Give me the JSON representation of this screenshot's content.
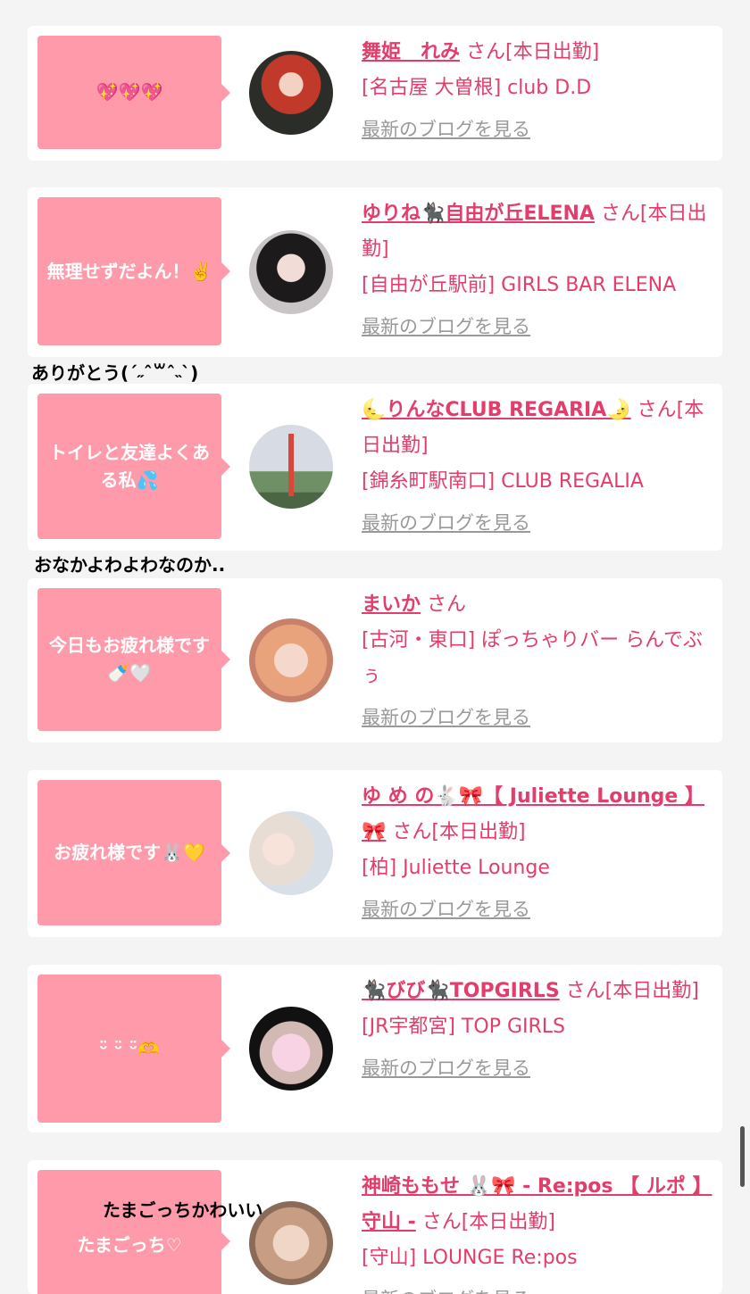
{
  "entries": [
    {
      "message": "💖💖💖",
      "name": "舞姫　れみ",
      "suffix": "さん[本日出勤]",
      "shop": "[名古屋 大曽根] club D.D",
      "blog_link": "最新のブログを見る"
    },
    {
      "message": "無理せずだよん！✌️",
      "name": "ゆりね🐈‍⬛自由が丘ELENA",
      "suffix": "さん[本日出勤]",
      "shop": "[自由が丘駅前] GIRLS BAR ELENA",
      "blog_link": "最新のブログを見る"
    },
    {
      "message": "トイレと友達よくある私💦",
      "name": "🌜りんなCLUB REGARIA🌛",
      "suffix": "さん[本日出勤]",
      "shop": "[錦糸町駅南口] CLUB REGALIA",
      "blog_link": "最新のブログを見る"
    },
    {
      "message": "今日もお疲れ様です🍼🤍",
      "name": "まいか",
      "suffix": "さん",
      "shop": "[古河・東口] ぽっちゃりバー らんでぶぅ",
      "blog_link": "最新のブログを見る"
    },
    {
      "message": "お疲れ様です🐰💛",
      "name": "ゆ め の🐇🎀【 Juliette Lounge 】🎀",
      "suffix": "さん[本日出勤]",
      "shop": "[柏] Juliette Lounge",
      "blog_link": "最新のブログを見る"
    },
    {
      "message": "ᵕ̈ ᵕ̈ ᵕ̈🫶",
      "name": "🐈‍⬛びび🐈‍⬛TOPGIRLS",
      "suffix": "さん[本日出勤]",
      "shop": "[JR宇都宮] TOP GIRLS",
      "blog_link": "最新のブログを見る"
    },
    {
      "message": "たまごっち♡",
      "name": "神崎ももせ 🐰🎀 - Re:pos 【 ルポ 】守山 -",
      "suffix": "さん[本日出勤]",
      "shop": "[守山] LOUNGE Re:pos",
      "blog_link": "最新のブログを見る"
    }
  ],
  "overlays": {
    "comment_1": "ありがとう(ˊ˶ˆ꒳ˆ˵ˋ)",
    "comment_2": "おなかよわよわなのか..",
    "comment_3": "たまごっちかわいい"
  }
}
